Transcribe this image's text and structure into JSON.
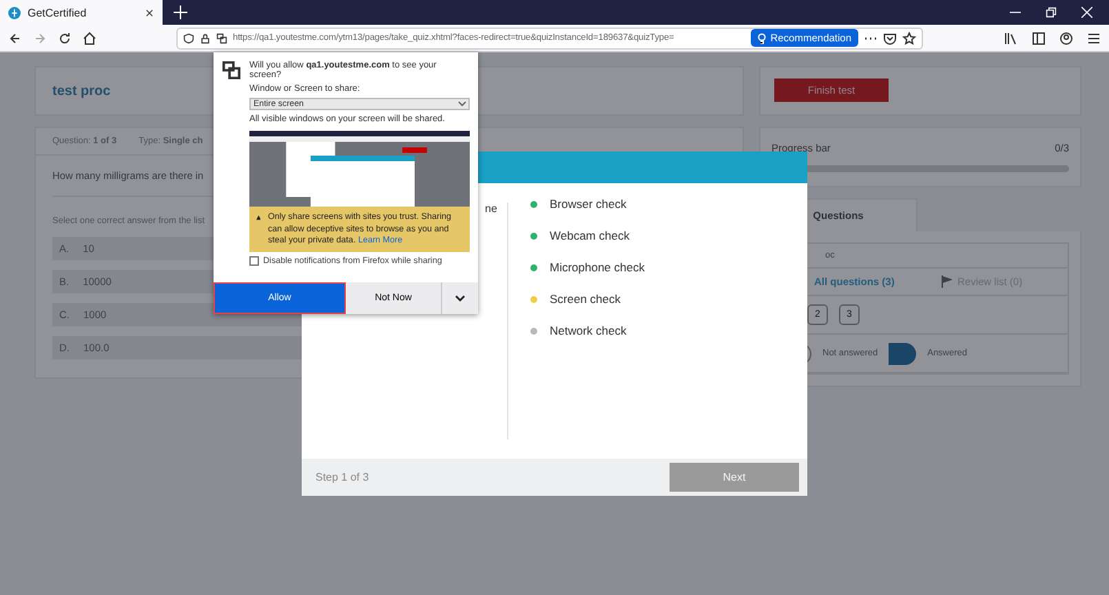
{
  "browser": {
    "tab": {
      "title": "GetCertified",
      "selected": true
    },
    "url": "https://qa1.youtestme.com/ytm13/pages/take_quiz.xhtml?faces-redirect=true&quizInstanceId=189637&quizType=",
    "recommendation": "Recommendation"
  },
  "quiz": {
    "title": "test proc",
    "question_label": "Question:",
    "question_number": "1 of 3",
    "type_label": "Type:",
    "type_value": "Single ch",
    "question": "How many milligrams are there in",
    "instruction": "Select one correct answer from the list",
    "answers": [
      {
        "letter": "A.",
        "text": "10"
      },
      {
        "letter": "B.",
        "text": "10000"
      },
      {
        "letter": "C.",
        "text": "1000"
      },
      {
        "letter": "D.",
        "text": "100.0"
      }
    ]
  },
  "sidebar": {
    "finish_button": "Finish test",
    "progress": {
      "label": "Progress bar",
      "count": "0/3",
      "level": 0
    },
    "tabs": [
      {
        "label": "Questions",
        "selected": true
      }
    ],
    "test_name": "oc",
    "filters": [
      {
        "label": "All questions (3)",
        "selected": true
      },
      {
        "label": "Review list (0)",
        "selected": false
      }
    ],
    "question_buttons": [
      "2",
      "3"
    ],
    "legend": [
      {
        "label": "Not answered",
        "kind": "outline"
      },
      {
        "label": "Answered",
        "kind": "filled"
      }
    ]
  },
  "modal": {
    "partial_text": "ne",
    "checks": [
      {
        "label": "Browser check",
        "color": "#2fb36b"
      },
      {
        "label": "Webcam check",
        "color": "#2fb36b"
      },
      {
        "label": "Microphone check",
        "color": "#2fb36b"
      },
      {
        "label": "Screen check",
        "color": "#f3cd4a"
      },
      {
        "label": "Network check",
        "color": "#b8b8b8"
      }
    ],
    "step": "Step 1 of 3",
    "next": {
      "label": "Next",
      "disabled": true
    }
  },
  "popup": {
    "question": "Will you allow **qa1.youtestme.com** to see your screen?",
    "select_label": "Window or Screen to share:",
    "select_value": "Entire screen",
    "note": "All visible windows on your screen will be shared.",
    "warning": "Only share screens with sites you trust. Sharing can allow deceptive sites to browse as you and steal your private data.",
    "learn_more": "Learn More",
    "checkbox": {
      "label": "Disable notifications from Firefox while sharing",
      "checked": false
    },
    "allow": "Allow",
    "not_now": "Not Now"
  }
}
